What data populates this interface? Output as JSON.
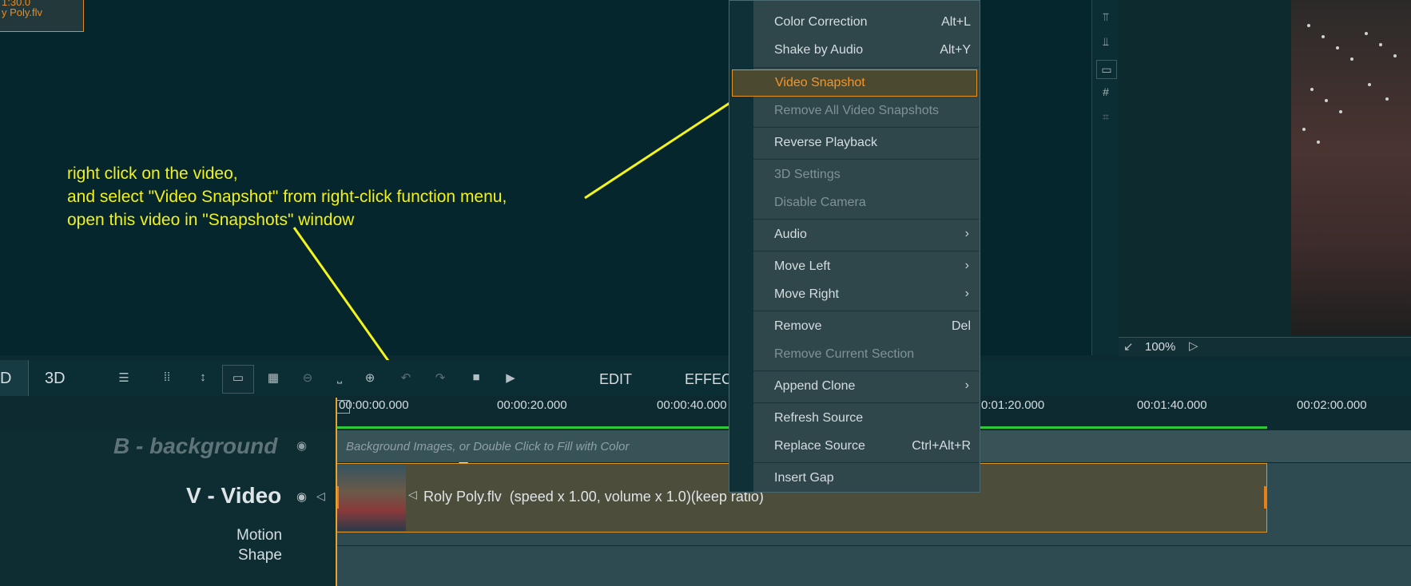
{
  "thumb": {
    "line1": "1:30.0",
    "line2": "y Poly.flv"
  },
  "annotation": {
    "text": "right click on the video,\nand select \"Video Snapshot\" from right-click function menu,\nopen this video in \"Snapshots\" window"
  },
  "menu": {
    "color_correction": {
      "label": "Color Correction",
      "shortcut": "Alt+L"
    },
    "shake_by_audio": {
      "label": "Shake by Audio",
      "shortcut": "Alt+Y"
    },
    "video_snapshot": {
      "label": "Video Snapshot"
    },
    "remove_all_snapshots": {
      "label": "Remove All Video Snapshots"
    },
    "reverse_playback": {
      "label": "Reverse Playback"
    },
    "settings_3d": {
      "label": "3D Settings"
    },
    "disable_camera": {
      "label": "Disable Camera"
    },
    "audio": {
      "label": "Audio"
    },
    "move_left": {
      "label": "Move Left"
    },
    "move_right": {
      "label": "Move Right"
    },
    "remove": {
      "label": "Remove",
      "shortcut": "Del"
    },
    "remove_current_section": {
      "label": "Remove Current Section"
    },
    "append_clone": {
      "label": "Append Clone"
    },
    "refresh_source": {
      "label": "Refresh Source"
    },
    "replace_source": {
      "label": "Replace Source",
      "shortcut": "Ctrl+Alt+R"
    },
    "insert_gap": {
      "label": "Insert Gap"
    },
    "submenu_arrow": "›"
  },
  "preview": {
    "zoom": "100%"
  },
  "toolbar": {
    "mode_2d": "D",
    "mode_3d": "3D",
    "edit": "EDIT",
    "effects": "EFFEC"
  },
  "ruler": {
    "ticks": [
      "00:00:00.000",
      "00:00:20.000",
      "00:00:40.000",
      "0:01:20.000",
      "00:01:40.000",
      "00:02:00.000"
    ]
  },
  "tracks": {
    "background": {
      "name": "B - background",
      "hint": "Background Images, or Double Click to Fill with Color"
    },
    "video": {
      "name": "V - Video",
      "clip_text": "Roly Poly.flv  (speed x 1.00, volume x 1.0)(keep ratio)",
      "motion": "Motion",
      "shape": "Shape"
    }
  },
  "colors": {
    "accent": "#f3952a",
    "annotation": "#f2f21a",
    "background": "#06262d",
    "menu_bg": "#2f474a",
    "progress": "#2fc83a"
  }
}
